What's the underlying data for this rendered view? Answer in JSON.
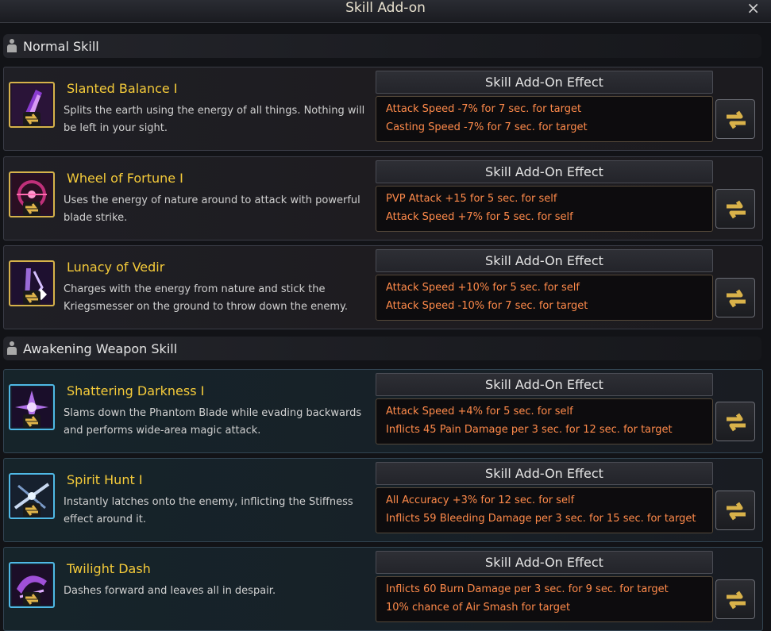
{
  "window": {
    "title": "Skill Add-on",
    "close_icon": "×"
  },
  "colors": {
    "skill_name": "#f5cb3a",
    "effect_text": "#ff8a4a",
    "normal_border": "#d6b24a",
    "awakening_border": "#4fb9e6"
  },
  "sections": [
    {
      "label": "Normal Skill",
      "skills": [
        {
          "name": "Slanted Balance I",
          "desc": "Splits the earth using the energy of all things. Nothing will be left in your sight.",
          "effect_title": "Skill Add-On Effect",
          "effects": [
            "Attack Speed -7% for 7 sec. for target",
            "Casting Speed -7% for 7 sec. for target"
          ],
          "icon": "slanted-balance-icon"
        },
        {
          "name": "Wheel of Fortune I",
          "desc": "Uses the energy of nature around to attack with powerful blade strike.",
          "effect_title": "Skill Add-On Effect",
          "effects": [
            "PVP Attack +15 for 5 sec. for self",
            "Attack Speed +7% for 5 sec. for self"
          ],
          "icon": "wheel-of-fortune-icon"
        },
        {
          "name": "Lunacy of Vedir",
          "desc": "Charges with the energy from nature and stick the Kriegsmesser on the ground to throw down the enemy.",
          "effect_title": "Skill Add-On Effect",
          "effects": [
            "Attack Speed +10% for 5 sec. for self",
            "Attack Speed -10% for 7 sec. for target"
          ],
          "icon": "lunacy-of-vedir-icon"
        }
      ]
    },
    {
      "label": "Awakening Weapon Skill",
      "skills": [
        {
          "name": "Shattering Darkness I",
          "desc": "Slams down the Phantom Blade while evading backwards and performs wide-area magic attack.",
          "effect_title": "Skill Add-On Effect",
          "effects": [
            "Attack Speed +4% for 5 sec. for self",
            "Inflicts 45 Pain Damage per 3 sec. for 12 sec. for target"
          ],
          "icon": "shattering-darkness-icon"
        },
        {
          "name": "Spirit Hunt I",
          "desc": "Instantly latches onto the enemy, inflicting the Stiffness effect around it.",
          "effect_title": "Skill Add-On Effect",
          "effects": [
            "All Accuracy +3% for 12 sec. for self",
            "Inflicts 59 Bleeding Damage per 3 sec. for 15 sec. for target"
          ],
          "icon": "spirit-hunt-icon"
        },
        {
          "name": "Twilight Dash",
          "desc": "Dashes forward and leaves all in despair.",
          "effect_title": "Skill Add-On Effect",
          "effects": [
            "Inflicts 60 Burn Damage per 3 sec. for 9 sec. for target",
            "10% chance of Air Smash for target"
          ],
          "icon": "twilight-dash-icon"
        }
      ]
    }
  ]
}
